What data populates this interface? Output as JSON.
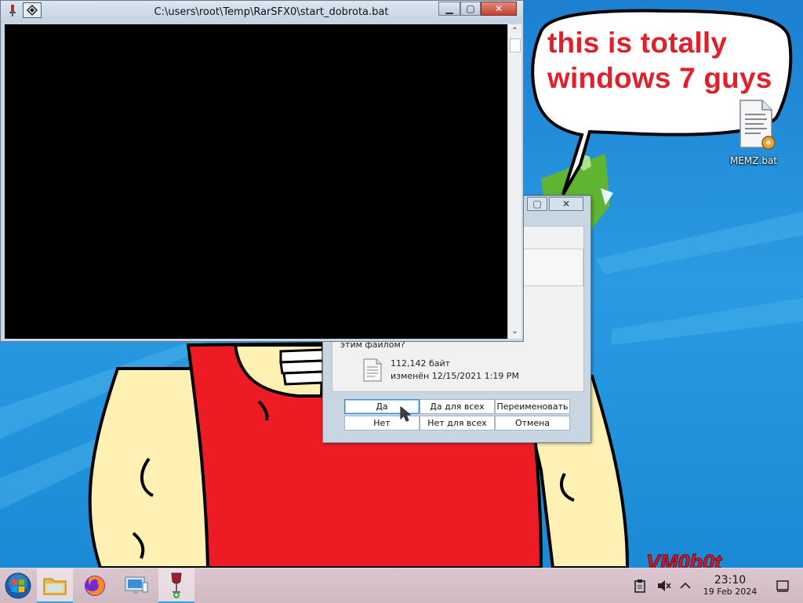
{
  "console": {
    "title": "C:\\users\\root\\Temp\\RarSFX0\\start_dobrota.bat",
    "minimize_glyph": "▁",
    "maximize_glyph": "▢",
    "close_glyph": "✕",
    "scroll_up_glyph": "⌃",
    "scroll_down_glyph": "⌄"
  },
  "bubble": {
    "line1": "this is totally",
    "line2": "windows 7 guys"
  },
  "desktop_icon": {
    "label": "MEMZ.bat"
  },
  "wallpaper_text": "VM0b0t",
  "dialog": {
    "maximize_glyph": "▢",
    "close_glyph": "✕",
    "question_tail": "этим файлом?",
    "file_size": "112,142 байт",
    "file_modified": "изменён 12/15/2021 1:19 PM",
    "buttons": {
      "yes": "Да",
      "yes_all": "Да для всех",
      "rename": "Переименовать",
      "no": "Нет",
      "no_all": "Нет для всех",
      "cancel": "Отмена"
    }
  },
  "taskbar": {
    "clock_time": "23:10",
    "clock_date": "19 Feb 2024"
  },
  "colors": {
    "accent": "#3a8fd8",
    "bubble_text": "#e0202a"
  }
}
